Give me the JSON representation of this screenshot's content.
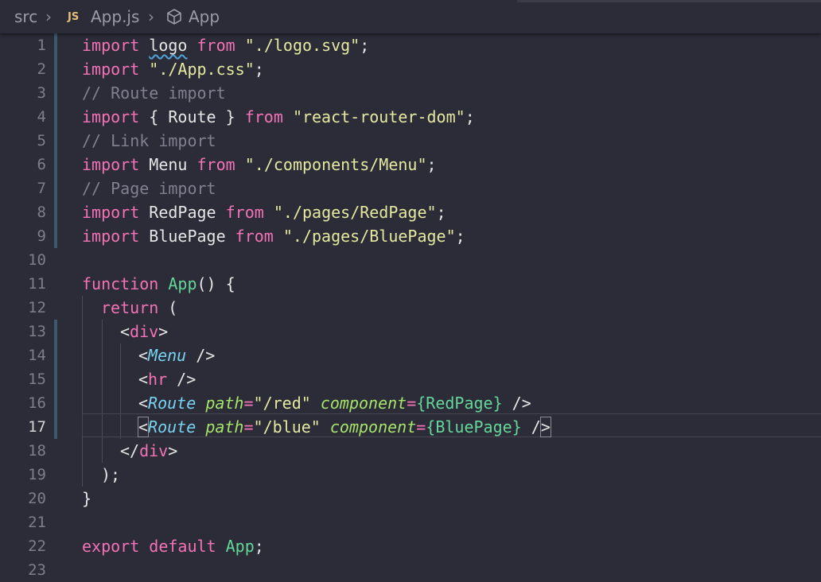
{
  "breadcrumb": {
    "folder": "src",
    "file_badge": "JS",
    "file": "App.js",
    "symbol": "App"
  },
  "editor": {
    "active_line": 17,
    "line_numbers": [
      "1",
      "2",
      "3",
      "4",
      "5",
      "6",
      "7",
      "8",
      "9",
      "10",
      "11",
      "12",
      "13",
      "14",
      "15",
      "16",
      "17",
      "18",
      "19",
      "20",
      "21",
      "22",
      "23"
    ],
    "code": {
      "l1": {
        "t1": "import",
        "t2": "logo",
        "t3": "from",
        "t4": "\"./logo.svg\"",
        "t5": ";"
      },
      "l2": {
        "t1": "import",
        "t2": "\"./App.css\"",
        "t3": ";"
      },
      "l3": {
        "t1": "// Route import"
      },
      "l4": {
        "t1": "import",
        "t2": "{ Route }",
        "t3": "from",
        "t4": "\"react-router-dom\"",
        "t5": ";"
      },
      "l5": {
        "t1": "// Link import"
      },
      "l6": {
        "t1": "import",
        "t2": "Menu",
        "t3": "from",
        "t4": "\"./components/Menu\"",
        "t5": ";"
      },
      "l7": {
        "t1": "// Page import"
      },
      "l8": {
        "t1": "import",
        "t2": "RedPage",
        "t3": "from",
        "t4": "\"./pages/RedPage\"",
        "t5": ";"
      },
      "l9": {
        "t1": "import",
        "t2": "BluePage",
        "t3": "from",
        "t4": "\"./pages/BluePage\"",
        "t5": ";"
      },
      "l11": {
        "t1": "function",
        "t2": "App",
        "t3": "() {"
      },
      "l12": {
        "t1": "return",
        "t2": "("
      },
      "l13": {
        "t1": "<",
        "t2": "div",
        "t3": ">"
      },
      "l14": {
        "t1": "<",
        "t2": "Menu",
        "t3": " />"
      },
      "l15": {
        "t1": "<",
        "t2": "hr",
        "t3": " />"
      },
      "l16": {
        "t1": "<",
        "t2": "Route",
        "t3": "path",
        "t4": "=",
        "t5": "\"/red\"",
        "t6": "component",
        "t7": "=",
        "t8": "{RedPage}",
        "t9": " />"
      },
      "l17": {
        "t1": "<",
        "t2": "Route",
        "t3": "path",
        "t4": "=",
        "t5": "\"/blue\"",
        "t6": "component",
        "t7": "=",
        "t8": "{BluePage}",
        "t9": " /",
        "t10": ">"
      },
      "l18": {
        "t1": "</",
        "t2": "div",
        "t3": ">"
      },
      "l19": {
        "t1": ");"
      },
      "l20": {
        "t1": "}"
      },
      "l22": {
        "t1": "export",
        "t2": "default",
        "t3": "App",
        "t4": ";"
      }
    }
  },
  "colors": {
    "background": "#2b2c37",
    "keyword": "#f472b6",
    "string": "#e5e9a0",
    "comment": "#7f8190",
    "function": "#65d69a",
    "jsx_tag": "#78d3f0",
    "attribute": "#a6e36b"
  }
}
